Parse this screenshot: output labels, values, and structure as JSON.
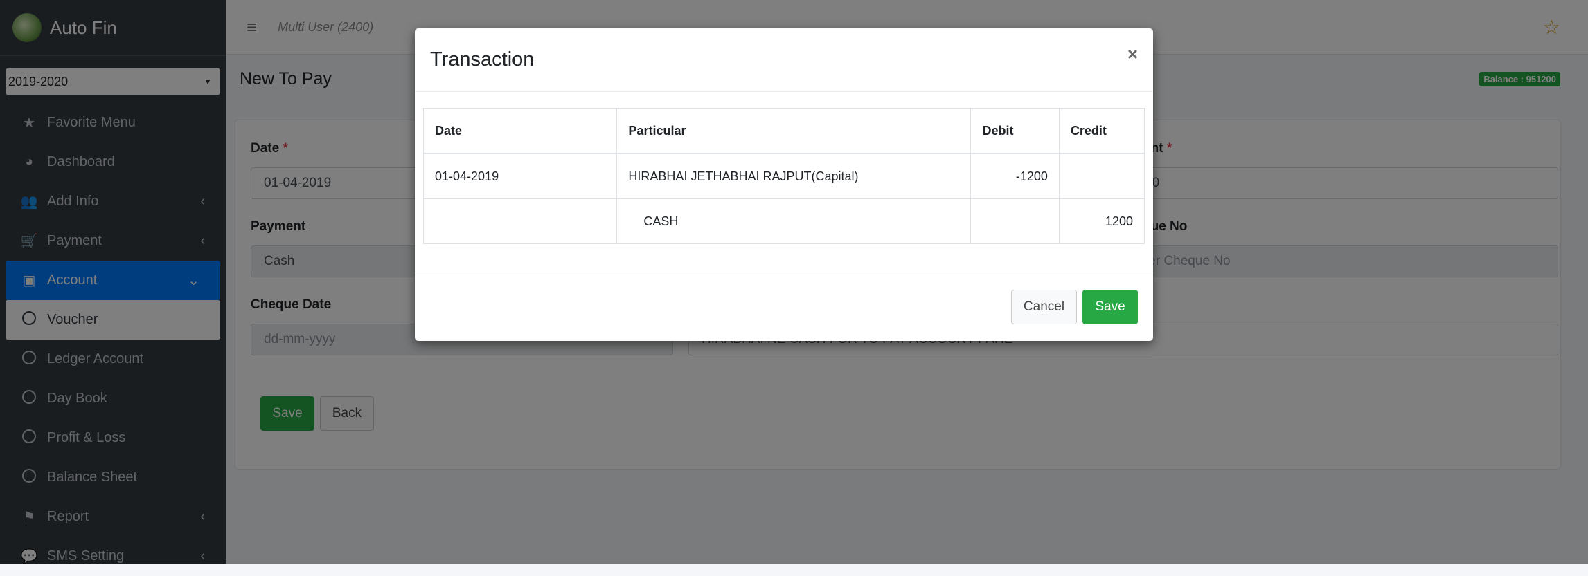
{
  "app": {
    "name": "Auto Fin"
  },
  "year_select": {
    "value": "2019-2020"
  },
  "sidebar": {
    "items": [
      {
        "label": "Favorite Menu",
        "icon": "star-icon"
      },
      {
        "label": "Dashboard",
        "icon": "dashboard-icon"
      },
      {
        "label": "Add Info",
        "icon": "users-icon"
      },
      {
        "label": "Payment",
        "icon": "cart-icon"
      },
      {
        "label": "Account",
        "icon": "money-icon"
      },
      {
        "label": "Voucher",
        "icon": "circle-icon"
      },
      {
        "label": "Ledger Account",
        "icon": "circle-icon"
      },
      {
        "label": "Day Book",
        "icon": "circle-icon"
      },
      {
        "label": "Profit & Loss",
        "icon": "circle-icon"
      },
      {
        "label": "Balance Sheet",
        "icon": "circle-icon"
      },
      {
        "label": "Report",
        "icon": "flag-icon"
      },
      {
        "label": "SMS Setting",
        "icon": "comment-icon"
      }
    ]
  },
  "topbar": {
    "user": "Multi User (2400)"
  },
  "page": {
    "title": "New To Pay",
    "balance": "Balance : 951200"
  },
  "form": {
    "date_label": "Date",
    "date_value": "01-04-2019",
    "amount_label_partial": "unt",
    "amount_value_partial": "00",
    "payment_label": "Payment",
    "payment_value": "Cash",
    "cheque_no_label_partial": "que No",
    "cheque_no_placeholder_partial": "ter Cheque No",
    "cheque_date_label": "Cheque Date",
    "cheque_date_placeholder": "dd-mm-yyyy",
    "remark_value": "HIRABHAI NE  CASH FOR TO PAY ACCOUNT PAHE",
    "save_label": "Save",
    "back_label": "Back"
  },
  "modal": {
    "title": "Transaction",
    "close": "×",
    "columns": [
      "Date",
      "Particular",
      "Debit",
      "Credit"
    ],
    "rows": [
      {
        "date": "01-04-2019",
        "particular": "HIRABHAI JETHABHAI RAJPUT(Capital)",
        "debit": "-1200",
        "credit": ""
      },
      {
        "date": "",
        "particular": "CASH",
        "debit": "",
        "credit": "1200"
      }
    ],
    "cancel_label": "Cancel",
    "save_label": "Save"
  },
  "colors": {
    "accent": "#007bff",
    "success": "#28a745",
    "sidebar": "#343a40",
    "star": "#d4a017"
  }
}
